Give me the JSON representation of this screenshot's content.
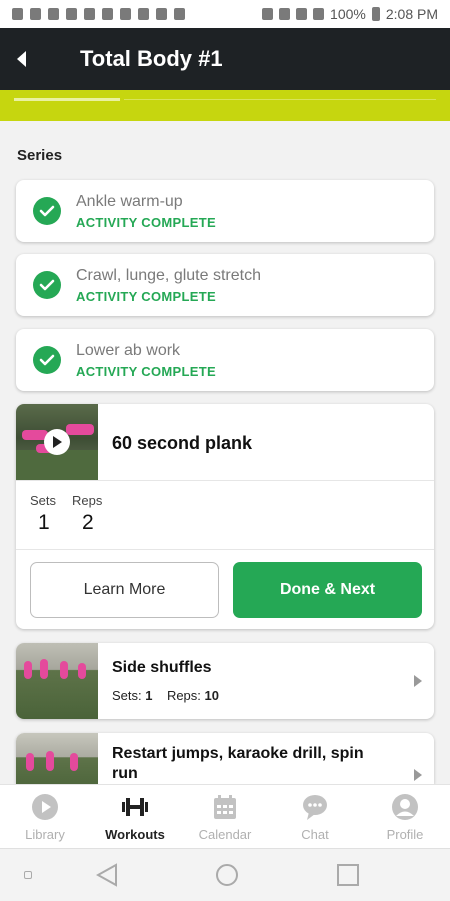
{
  "status_bar": {
    "battery": "100%",
    "time": "2:08 PM"
  },
  "header": {
    "title": "Total Body #1"
  },
  "series": {
    "title": "Series",
    "completed": [
      {
        "name": "Ankle warm-up",
        "status": "ACTIVITY COMPLETE"
      },
      {
        "name": "Crawl, lunge, glute stretch",
        "status": "ACTIVITY COMPLETE"
      },
      {
        "name": "Lower ab work",
        "status": "ACTIVITY COMPLETE"
      }
    ],
    "active": {
      "name": "60 second plank",
      "sets_label": "Sets",
      "sets": "1",
      "reps_label": "Reps",
      "reps": "2",
      "learn_more": "Learn More",
      "done_next": "Done & Next"
    },
    "upcoming": [
      {
        "name": "Side shuffles",
        "sets_label": "Sets:",
        "sets": "1",
        "reps_label": "Reps:",
        "reps": "10"
      },
      {
        "name": "Restart jumps, karaoke drill, spin run"
      }
    ]
  },
  "bottom_nav": [
    {
      "label": "Library",
      "icon": "play-circle-icon",
      "active": false
    },
    {
      "label": "Workouts",
      "icon": "dumbbell-icon",
      "active": true
    },
    {
      "label": "Calendar",
      "icon": "calendar-icon",
      "active": false
    },
    {
      "label": "Chat",
      "icon": "chat-icon",
      "active": false
    },
    {
      "label": "Profile",
      "icon": "profile-icon",
      "active": false
    }
  ],
  "colors": {
    "accent_green": "#25a855",
    "lime": "#c6d60f",
    "header_bg": "#1e2225"
  }
}
